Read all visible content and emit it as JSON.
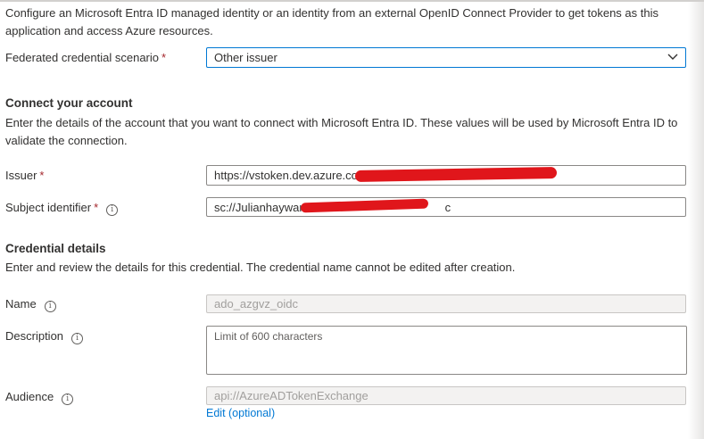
{
  "intro_text": "Configure an Microsoft Entra ID managed identity or an identity from an external OpenID Connect Provider to get tokens as this application and access Azure resources.",
  "scenario": {
    "label": "Federated credential scenario",
    "required_mark": "*",
    "value": "Other issuer"
  },
  "connect": {
    "title": "Connect your account",
    "description": "Enter the details of the account that you want to connect with Microsoft Entra ID. These values will be used by Microsoft Entra ID to validate the connection.",
    "issuer": {
      "label": "Issuer",
      "required_mark": "*",
      "value": "https://vstoken.dev.azure.com/"
    },
    "subject": {
      "label": "Subject identifier",
      "required_mark": "*",
      "value": "sc://Julianhayward/",
      "value_suffix": "c"
    }
  },
  "credential": {
    "title": "Credential details",
    "description": "Enter and review the details for this credential. The credential name cannot be edited after creation.",
    "name": {
      "label": "Name",
      "value": "ado_azgvz_oidc"
    },
    "description_field": {
      "label": "Description",
      "placeholder": "Limit of 600 characters"
    },
    "audience": {
      "label": "Audience",
      "value": "api://AzureADTokenExchange",
      "edit_link": "Edit (optional)"
    }
  },
  "icons": {
    "info": "info-icon",
    "chevron": "chevron-down-icon"
  },
  "colors": {
    "accent": "#0078d4",
    "required": "#a4262c",
    "redaction": "#e0161b",
    "disabled_bg": "#f3f2f1"
  }
}
